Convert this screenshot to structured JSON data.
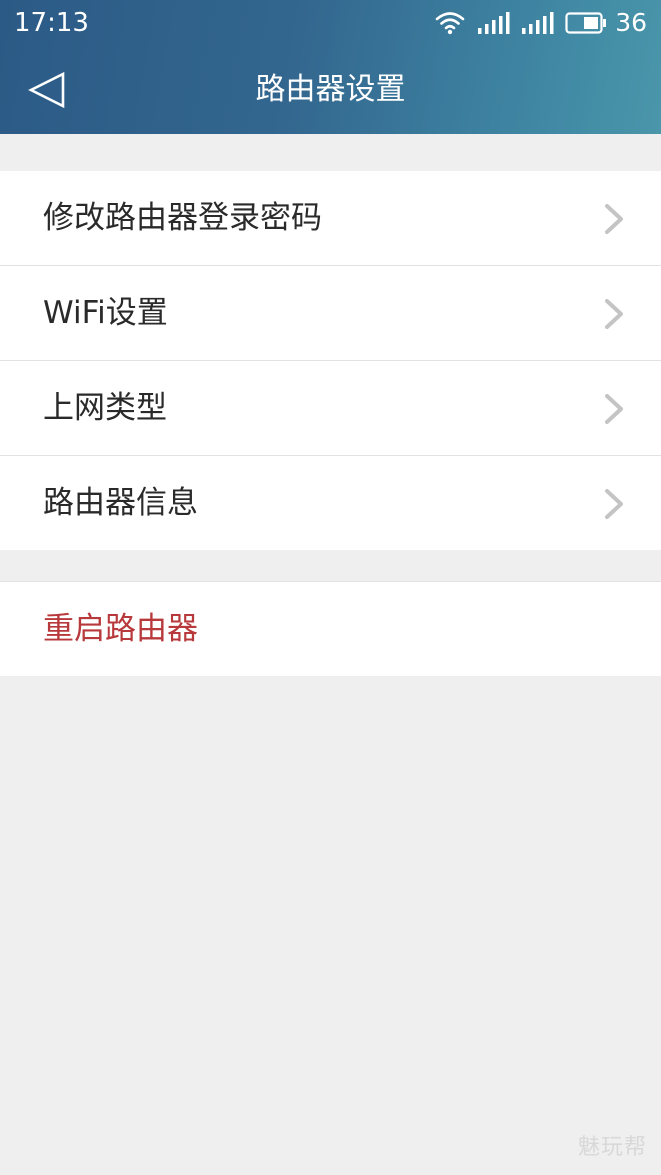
{
  "status_bar": {
    "time": "17:13",
    "battery_level": "36",
    "icons": [
      "wifi-icon",
      "signal-icon",
      "signal-icon",
      "battery-icon"
    ]
  },
  "nav": {
    "back_icon": "back-triangle-icon",
    "title": "路由器设置"
  },
  "menu": {
    "items": [
      {
        "label": "修改路由器登录密码",
        "icon": "chevron-right-icon"
      },
      {
        "label": "WiFi设置",
        "icon": "chevron-right-icon"
      },
      {
        "label": "上网类型",
        "icon": "chevron-right-icon"
      },
      {
        "label": "路由器信息",
        "icon": "chevron-right-icon"
      }
    ],
    "restart_label": "重启路由器"
  },
  "watermark": "魅玩帮",
  "colors": {
    "header_start": "#2b5a86",
    "header_end": "#4a96aa",
    "background": "#efefef",
    "danger_text": "#b8393b",
    "chevron": "#c4c4c4"
  }
}
